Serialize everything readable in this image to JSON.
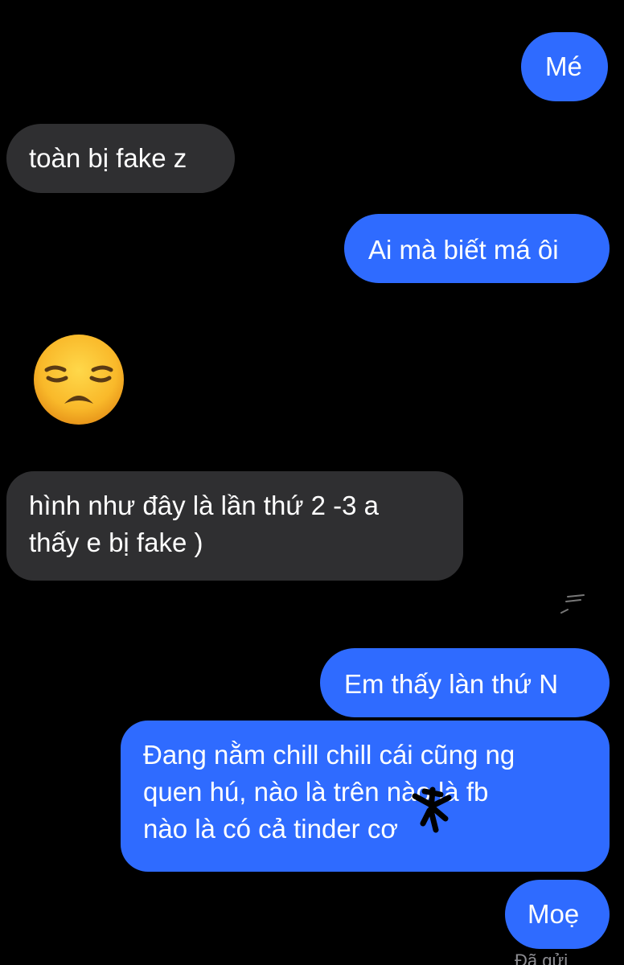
{
  "messages": [
    {
      "side": "out",
      "text": "Mé"
    },
    {
      "side": "in",
      "text": "toàn bị fake z"
    },
    {
      "side": "out",
      "text": "Ai mà biết má ôi"
    },
    {
      "side": "in",
      "emoji": "disappointed-face"
    },
    {
      "side": "in",
      "lines": [
        "hình như đây là lần thứ 2 -3 a",
        "thấy e bị fake )"
      ]
    },
    {
      "side": "out",
      "text": "Em thấy làn thứ N"
    },
    {
      "side": "out",
      "lines": [
        "Đang nằm chill chill cái cũng ng",
        "quen hú, nào là trên   nào là fb",
        "nào là có cả tinder cơ"
      ]
    },
    {
      "side": "out",
      "text": "Moẹ"
    }
  ],
  "status": "Đã gửi",
  "colors": {
    "background": "#000000",
    "outgoing_bubble": "#2f6bff",
    "incoming_bubble": "#2f2f31",
    "status_text": "#8e8e93"
  }
}
